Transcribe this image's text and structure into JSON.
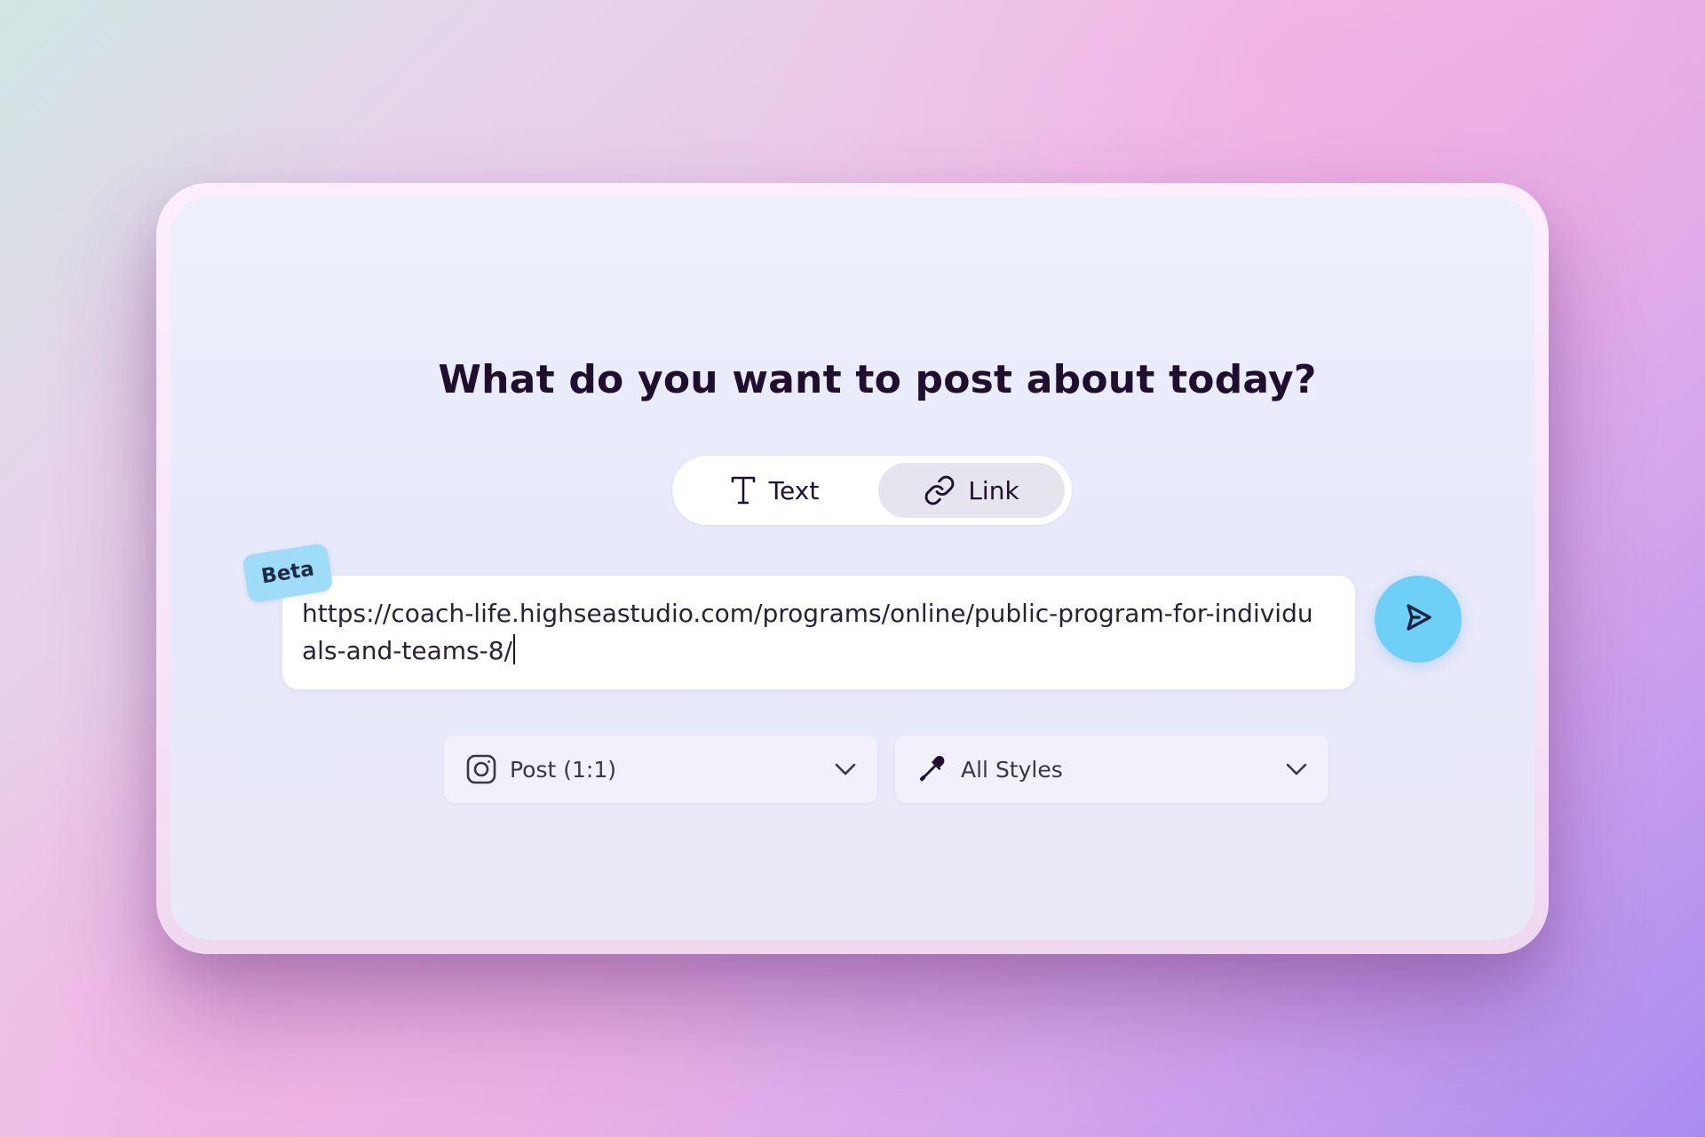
{
  "heading": "What do you want to post about today?",
  "mode_toggle": {
    "tabs": [
      {
        "label": "Text",
        "icon": "text-type-icon",
        "selected": false
      },
      {
        "label": "Link",
        "icon": "link-icon",
        "selected": true
      }
    ]
  },
  "link_input": {
    "badge": "Beta",
    "value": "https://coach-life.highseastudio.com/programs/online/public-program-for-individuals-and-teams-8/"
  },
  "send_button": {
    "icon": "send-arrow-icon"
  },
  "options": {
    "format": {
      "icon": "instagram-icon",
      "selected": "Post (1:1)"
    },
    "style": {
      "icon": "eyedropper-icon",
      "selected": "All Styles"
    }
  },
  "colors": {
    "accent": "#6ed0f6",
    "badge": "#9fdcf8",
    "heading_text": "#1e0f2e",
    "selected_tab": "#e6e4ee"
  }
}
